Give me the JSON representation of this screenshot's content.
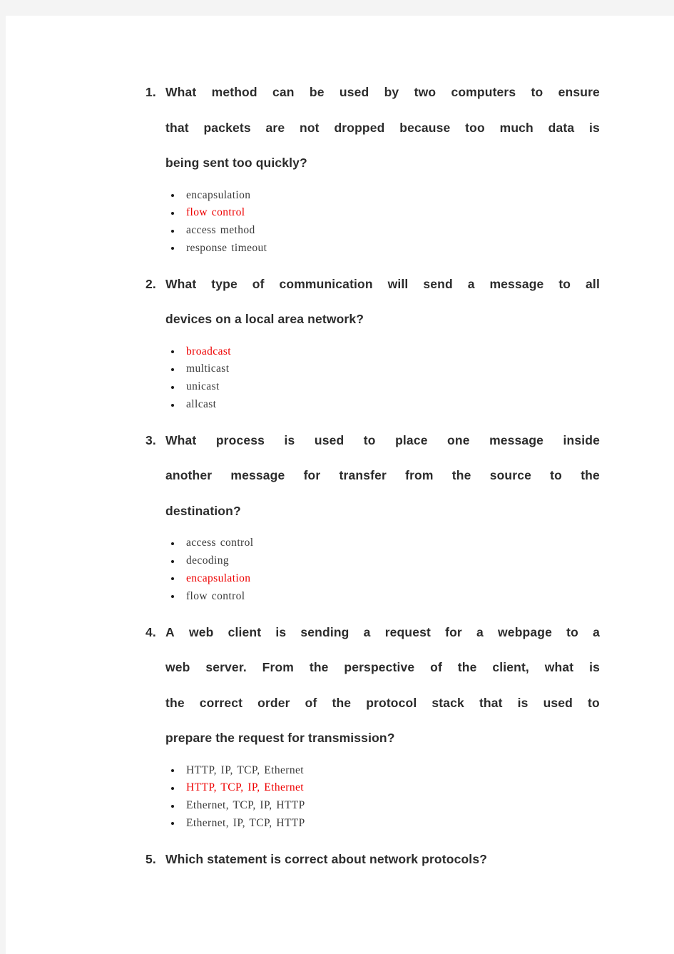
{
  "page": {
    "background_color": "#f4f4f4",
    "paper_color": "#ffffff",
    "question_text_color": "#2b2b2b",
    "option_text_color": "#3a3a3a",
    "correct_answer_color": "#ee0000"
  },
  "questions": [
    {
      "number": "1.",
      "lines": [
        "What method can be used by two computers to ensure",
        "that packets are not dropped because too much data is",
        "being sent too quickly?"
      ],
      "text": "What method can be used by two computers to ensure that packets are not dropped because too much data is being sent too quickly?",
      "options": [
        {
          "label": "encapsulation",
          "correct": false
        },
        {
          "label": "flow control",
          "correct": true
        },
        {
          "label": "access method",
          "correct": false
        },
        {
          "label": "response timeout",
          "correct": false
        }
      ]
    },
    {
      "number": "2.",
      "lines": [
        "What type of communication will send a message to all",
        "devices on a local area network?"
      ],
      "text": "What type of communication will send a message to all devices on a local area network?",
      "options": [
        {
          "label": "broadcast",
          "correct": true
        },
        {
          "label": "multicast",
          "correct": false
        },
        {
          "label": "unicast",
          "correct": false
        },
        {
          "label": "allcast",
          "correct": false
        }
      ]
    },
    {
      "number": "3.",
      "lines": [
        "What process is used to place one message inside",
        "another message for transfer from the source to the",
        "destination?"
      ],
      "text": "What process is used to place one message inside another message for transfer from the source to the destination?",
      "options": [
        {
          "label": "access control",
          "correct": false
        },
        {
          "label": "decoding",
          "correct": false
        },
        {
          "label": "encapsulation",
          "correct": true
        },
        {
          "label": "flow control",
          "correct": false
        }
      ]
    },
    {
      "number": "4.",
      "lines": [
        "A web client is sending a request for a webpage to a",
        "web server. From the perspective of the client, what is",
        "the correct order of the protocol stack that is used to",
        "prepare the request for transmission?"
      ],
      "text": "A web client is sending a request for a webpage to a web server. From the perspective of the client, what is the correct order of the protocol stack that is used to prepare the request for transmission?",
      "options": [
        {
          "label": "HTTP, IP, TCP, Ethernet",
          "correct": false
        },
        {
          "label": "HTTP, TCP, IP, Ethernet",
          "correct": true
        },
        {
          "label": "Ethernet, TCP, IP, HTTP",
          "correct": false
        },
        {
          "label": "Ethernet, IP, TCP, HTTP",
          "correct": false
        }
      ]
    },
    {
      "number": "5.",
      "lines": [
        "Which statement is correct about network protocols?"
      ],
      "text": "Which statement is correct about network protocols?",
      "options": []
    }
  ]
}
